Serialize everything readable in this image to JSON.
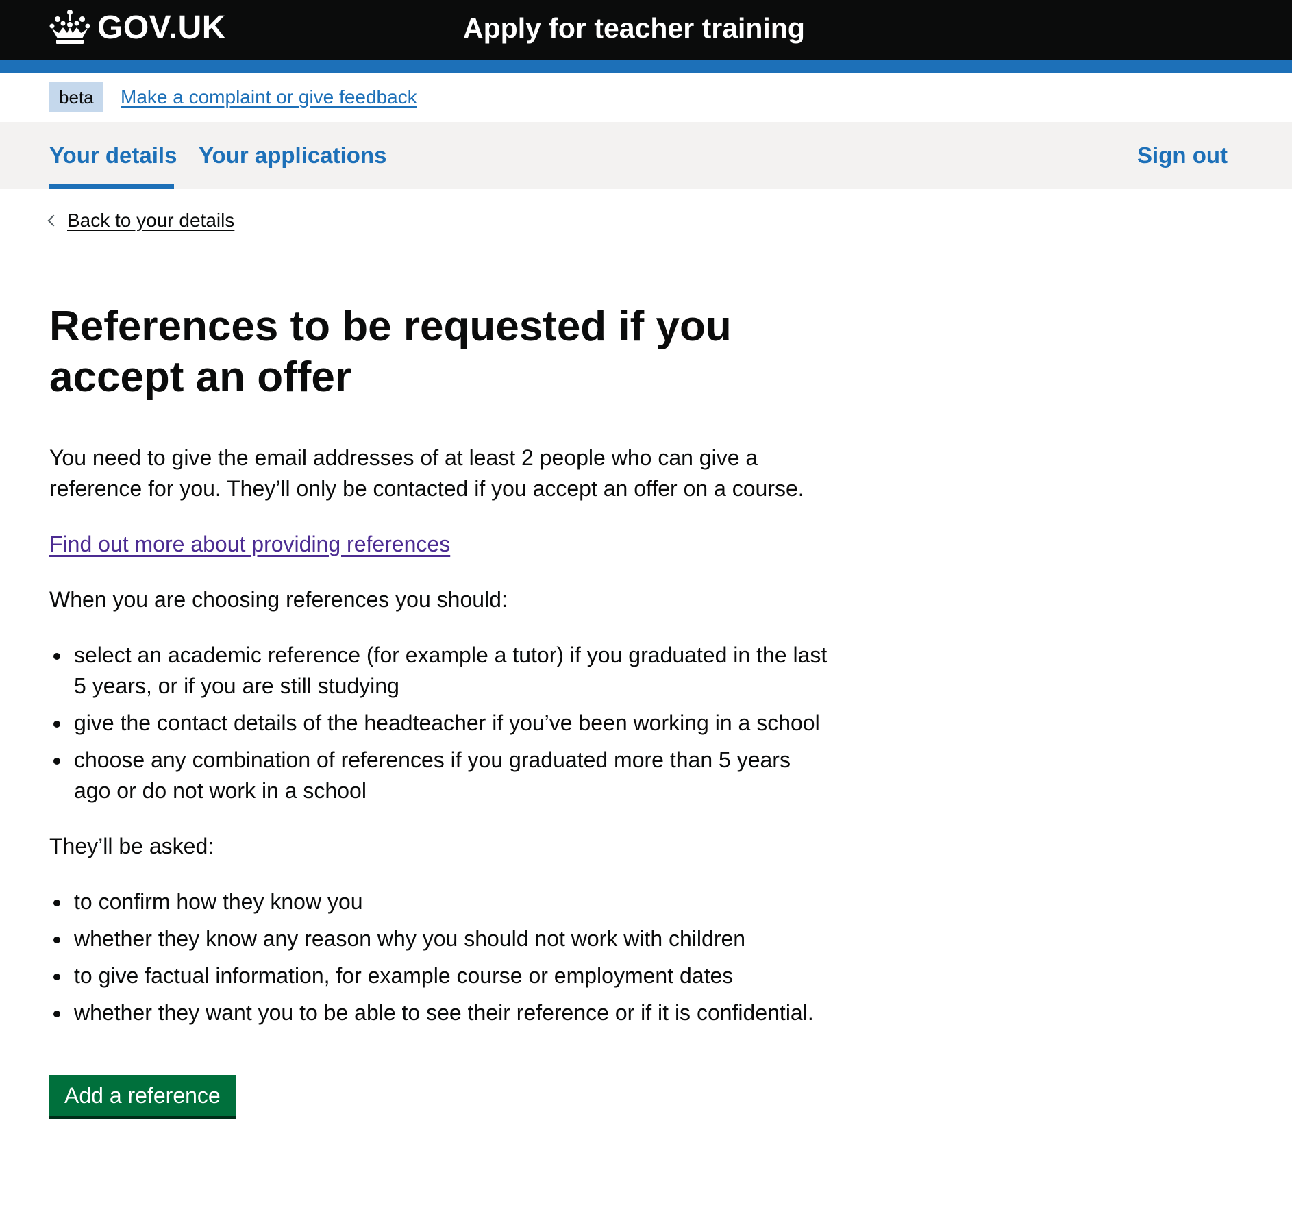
{
  "header": {
    "logo_text": "GOV.UK",
    "service_name": "Apply for teacher training"
  },
  "phase_banner": {
    "tag": "beta",
    "feedback_link": "Make a complaint or give feedback"
  },
  "nav": {
    "items": [
      {
        "label": "Your details",
        "active": true
      },
      {
        "label": "Your applications",
        "active": false
      }
    ],
    "sign_out": "Sign out"
  },
  "back_link": "Back to your details",
  "main": {
    "title": "References to be requested if you accept an offer",
    "intro": "You need to give the email addresses of at least 2 people who can give a reference for you. They’ll only be contacted if you accept an offer on a course.",
    "find_out_more_link": "Find out more about providing references",
    "choosing_lead": "When you are choosing references you should:",
    "choosing_items": [
      "select an academic reference (for example a tutor) if you graduated in the last 5 years, or if you are still studying",
      "give the contact details of the headteacher if you’ve been working in a school",
      "choose any combination of references if you graduated more than 5 years ago or do not work in a school"
    ],
    "asked_lead": "They’ll be asked:",
    "asked_items": [
      "to confirm how they know you",
      "whether they know any reason why you should not work with children",
      "to give factual information, for example course or employment dates",
      "whether they want you to be able to see their reference or if it is confidential."
    ],
    "button_label": "Add a reference"
  },
  "colors": {
    "header_bg": "#0b0c0c",
    "brand_blue": "#1d70b8",
    "visited_link": "#4c2c92",
    "button_green": "#00703c",
    "nav_bg": "#f3f2f1",
    "tag_bg": "#c5d8ec"
  }
}
